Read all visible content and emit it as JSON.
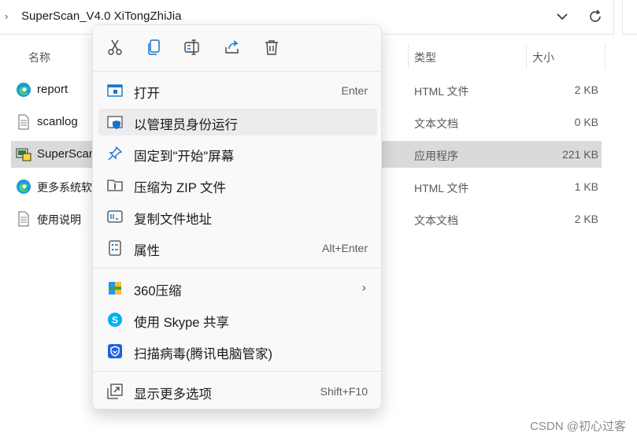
{
  "address": {
    "path": "SuperScan_V4.0  XiTongZhiJia"
  },
  "columns": {
    "name": "名称",
    "type": "类型",
    "size": "大小"
  },
  "files": [
    {
      "name": "report",
      "type": "HTML 文件",
      "size": "2 KB",
      "icon": "edge-icon"
    },
    {
      "name": "scanlog",
      "type": "文本文档",
      "size": "0 KB",
      "icon": "text-file-icon"
    },
    {
      "name": "SuperScan",
      "type": "应用程序",
      "size": "221 KB",
      "icon": "app-icon"
    },
    {
      "name": "更多系统软件",
      "type": "HTML 文件",
      "size": "1 KB",
      "icon": "edge-icon"
    },
    {
      "name": "使用说明",
      "type": "文本文档",
      "size": "2 KB",
      "icon": "text-file-icon"
    }
  ],
  "context_menu": {
    "toolbar": [
      "cut-icon",
      "copy-icon",
      "rename-icon",
      "share-icon",
      "delete-icon"
    ],
    "items": [
      {
        "label": "打开",
        "shortcut": "Enter",
        "icon": "open-icon"
      },
      {
        "label": "以管理员身份运行",
        "shortcut": "",
        "icon": "shield-icon"
      },
      {
        "label": "固定到\"开始\"屏幕",
        "shortcut": "",
        "icon": "pin-icon"
      },
      {
        "label": "压缩为 ZIP 文件",
        "shortcut": "",
        "icon": "zip-icon"
      },
      {
        "label": "复制文件地址",
        "shortcut": "",
        "icon": "copy-path-icon"
      },
      {
        "label": "属性",
        "shortcut": "Alt+Enter",
        "icon": "properties-icon"
      },
      {
        "label": "360压缩",
        "shortcut": "",
        "icon": "archive-360-icon"
      },
      {
        "label": "使用 Skype 共享",
        "shortcut": "",
        "icon": "skype-icon"
      },
      {
        "label": "扫描病毒(腾讯电脑管家)",
        "shortcut": "",
        "icon": "tencent-shield-icon"
      },
      {
        "label": "显示更多选项",
        "shortcut": "Shift+F10",
        "icon": "more-options-icon"
      }
    ]
  },
  "watermark": "CSDN @初心过客",
  "colors": {
    "selection": "#dadada",
    "menu_bg": "#f9f9f9",
    "accent": "#0067c0"
  }
}
